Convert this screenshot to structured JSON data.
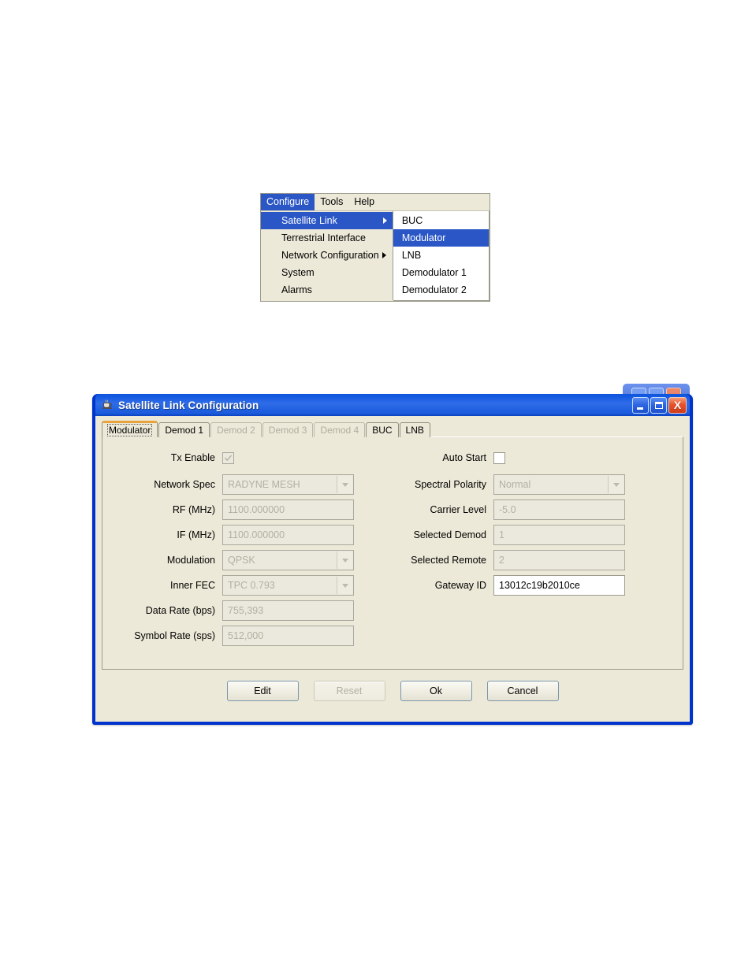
{
  "menu": {
    "bar_items": [
      {
        "label": "Configure",
        "selected": true
      },
      {
        "label": "Tools",
        "selected": false
      },
      {
        "label": "Help",
        "selected": false
      }
    ],
    "dropdown_items": [
      {
        "label": "Satellite Link",
        "selected": true,
        "has_submenu": true
      },
      {
        "label": "Terrestrial Interface",
        "selected": false,
        "has_submenu": false
      },
      {
        "label": "Network Configuration",
        "selected": false,
        "has_submenu": true
      },
      {
        "label": "System",
        "selected": false,
        "has_submenu": false
      },
      {
        "label": "Alarms",
        "selected": false,
        "has_submenu": false
      }
    ],
    "submenu_items": [
      {
        "label": "BUC",
        "selected": false
      },
      {
        "label": "Modulator",
        "selected": true
      },
      {
        "label": "LNB",
        "selected": false
      },
      {
        "label": "Demodulator 1",
        "selected": false
      },
      {
        "label": "Demodulator 2",
        "selected": false
      }
    ]
  },
  "dialog": {
    "title": "Satellite Link Configuration",
    "title_icon": "java-coffee-cup-icon",
    "window_buttons": {
      "minimize": "minimize-icon",
      "maximize": "maximize-icon",
      "close_label": "X"
    },
    "tabs": [
      {
        "label": "Modulator",
        "active": true,
        "disabled": false
      },
      {
        "label": "Demod 1",
        "active": false,
        "disabled": false
      },
      {
        "label": "Demod 2",
        "active": false,
        "disabled": true
      },
      {
        "label": "Demod 3",
        "active": false,
        "disabled": true
      },
      {
        "label": "Demod 4",
        "active": false,
        "disabled": true
      },
      {
        "label": "BUC",
        "active": false,
        "disabled": false
      },
      {
        "label": "LNB",
        "active": false,
        "disabled": false
      }
    ],
    "left_column": [
      {
        "label": "Tx Enable",
        "type": "checkbox",
        "checked": true,
        "enabled": false
      },
      {
        "label": "Network Spec",
        "type": "combo",
        "value": "RADYNE MESH",
        "enabled": false
      },
      {
        "label": "RF (MHz)",
        "type": "text",
        "value": "1100.000000",
        "enabled": false
      },
      {
        "label": "IF (MHz)",
        "type": "text",
        "value": "1100.000000",
        "enabled": false
      },
      {
        "label": "Modulation",
        "type": "combo",
        "value": "QPSK",
        "enabled": false
      },
      {
        "label": "Inner FEC",
        "type": "combo",
        "value": "TPC 0.793",
        "enabled": false
      },
      {
        "label": "Data Rate (bps)",
        "type": "text",
        "value": "755,393",
        "enabled": false
      },
      {
        "label": "Symbol Rate (sps)",
        "type": "text",
        "value": "512,000",
        "enabled": false
      }
    ],
    "right_column": [
      {
        "label": "Auto Start",
        "type": "checkbox",
        "checked": false,
        "enabled": false
      },
      {
        "label": "Spectral Polarity",
        "type": "combo",
        "value": "Normal",
        "enabled": false
      },
      {
        "label": "Carrier Level",
        "type": "text",
        "value": "-5.0",
        "enabled": false
      },
      {
        "label": "Selected Demod",
        "type": "text",
        "value": "1",
        "enabled": false
      },
      {
        "label": "Selected Remote",
        "type": "text",
        "value": "2",
        "enabled": false
      },
      {
        "label": "Gateway ID",
        "type": "text",
        "value": "13012c19b2010ce",
        "enabled": true
      }
    ],
    "buttons": [
      {
        "label": "Edit",
        "disabled": false
      },
      {
        "label": "Reset",
        "disabled": true
      },
      {
        "label": "Ok",
        "disabled": false
      },
      {
        "label": "Cancel",
        "disabled": false
      }
    ]
  },
  "colors": {
    "menu_highlight": "#2a56c6",
    "window_border": "#0033cc",
    "titlebar": "#1157e0",
    "panel_bg": "#ece9d8",
    "active_tab_accent": "#e8a33d",
    "close_button": "#e8512a"
  }
}
